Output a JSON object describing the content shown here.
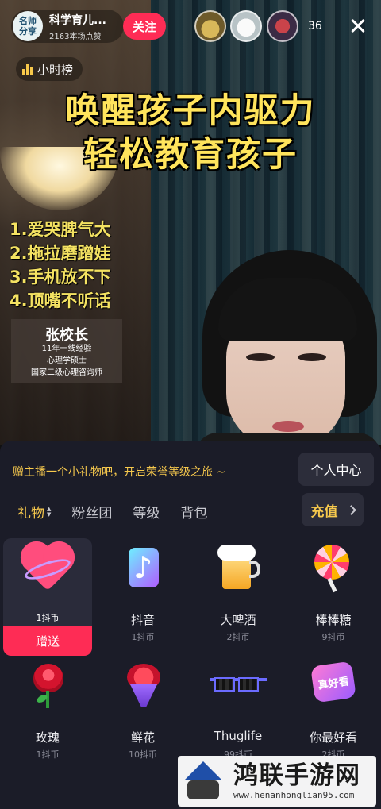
{
  "header": {
    "host_avatar_text": [
      "名师",
      "分享"
    ],
    "host_name": "科学育儿...",
    "host_likes": "2163本场点赞",
    "follow_label": "关注",
    "viewer_count": "36"
  },
  "stream": {
    "hourly_rank_label": "小时榜",
    "headline_1": "唤醒孩子内驱力",
    "headline_2": "轻松教育孩子",
    "points": [
      "1.爱哭脾气大",
      "2.拖拉磨蹭娃",
      "3.手机放不下",
      "4.顶嘴不听话"
    ],
    "teacher": {
      "name": "张校长",
      "lines": [
        "11年一线经验",
        "心理学硕士",
        "国家二级心理咨询师"
      ]
    }
  },
  "gift_panel": {
    "promo_text": "赠主播一个小礼物吧，开启荣誉等级之旅 ~",
    "personal_center_label": "个人中心",
    "tabs": [
      "礼物",
      "粉丝团",
      "等级",
      "背包"
    ],
    "active_tab": "礼物",
    "recharge_label": "充值",
    "send_label": "赠送",
    "gifts": [
      {
        "name": "",
        "price": "1抖币",
        "icon": "heart-icon",
        "selected": true
      },
      {
        "name": "抖音",
        "price": "1抖币",
        "icon": "douyin-note-icon"
      },
      {
        "name": "大啤酒",
        "price": "2抖币",
        "icon": "beer-icon"
      },
      {
        "name": "棒棒糖",
        "price": "9抖币",
        "icon": "lollipop-icon"
      },
      {
        "name": "玫瑰",
        "price": "1抖币",
        "icon": "rose-icon"
      },
      {
        "name": "鲜花",
        "price": "10抖币",
        "icon": "bouquet-icon"
      },
      {
        "name": "Thuglife",
        "price": "99抖币",
        "icon": "sunglasses-icon"
      },
      {
        "name": "你最好看",
        "price": "2抖币",
        "icon": "heart-badge-icon",
        "badge_text": "真好看"
      }
    ]
  },
  "watermark": {
    "name": "鸿联手游网",
    "url": "www.henanhonglian95.com"
  },
  "colors": {
    "accent_red": "#fe2c55",
    "gold": "#f7c94d",
    "panel_bg": "#1b1c28",
    "headline_yellow": "#ffe45c"
  }
}
